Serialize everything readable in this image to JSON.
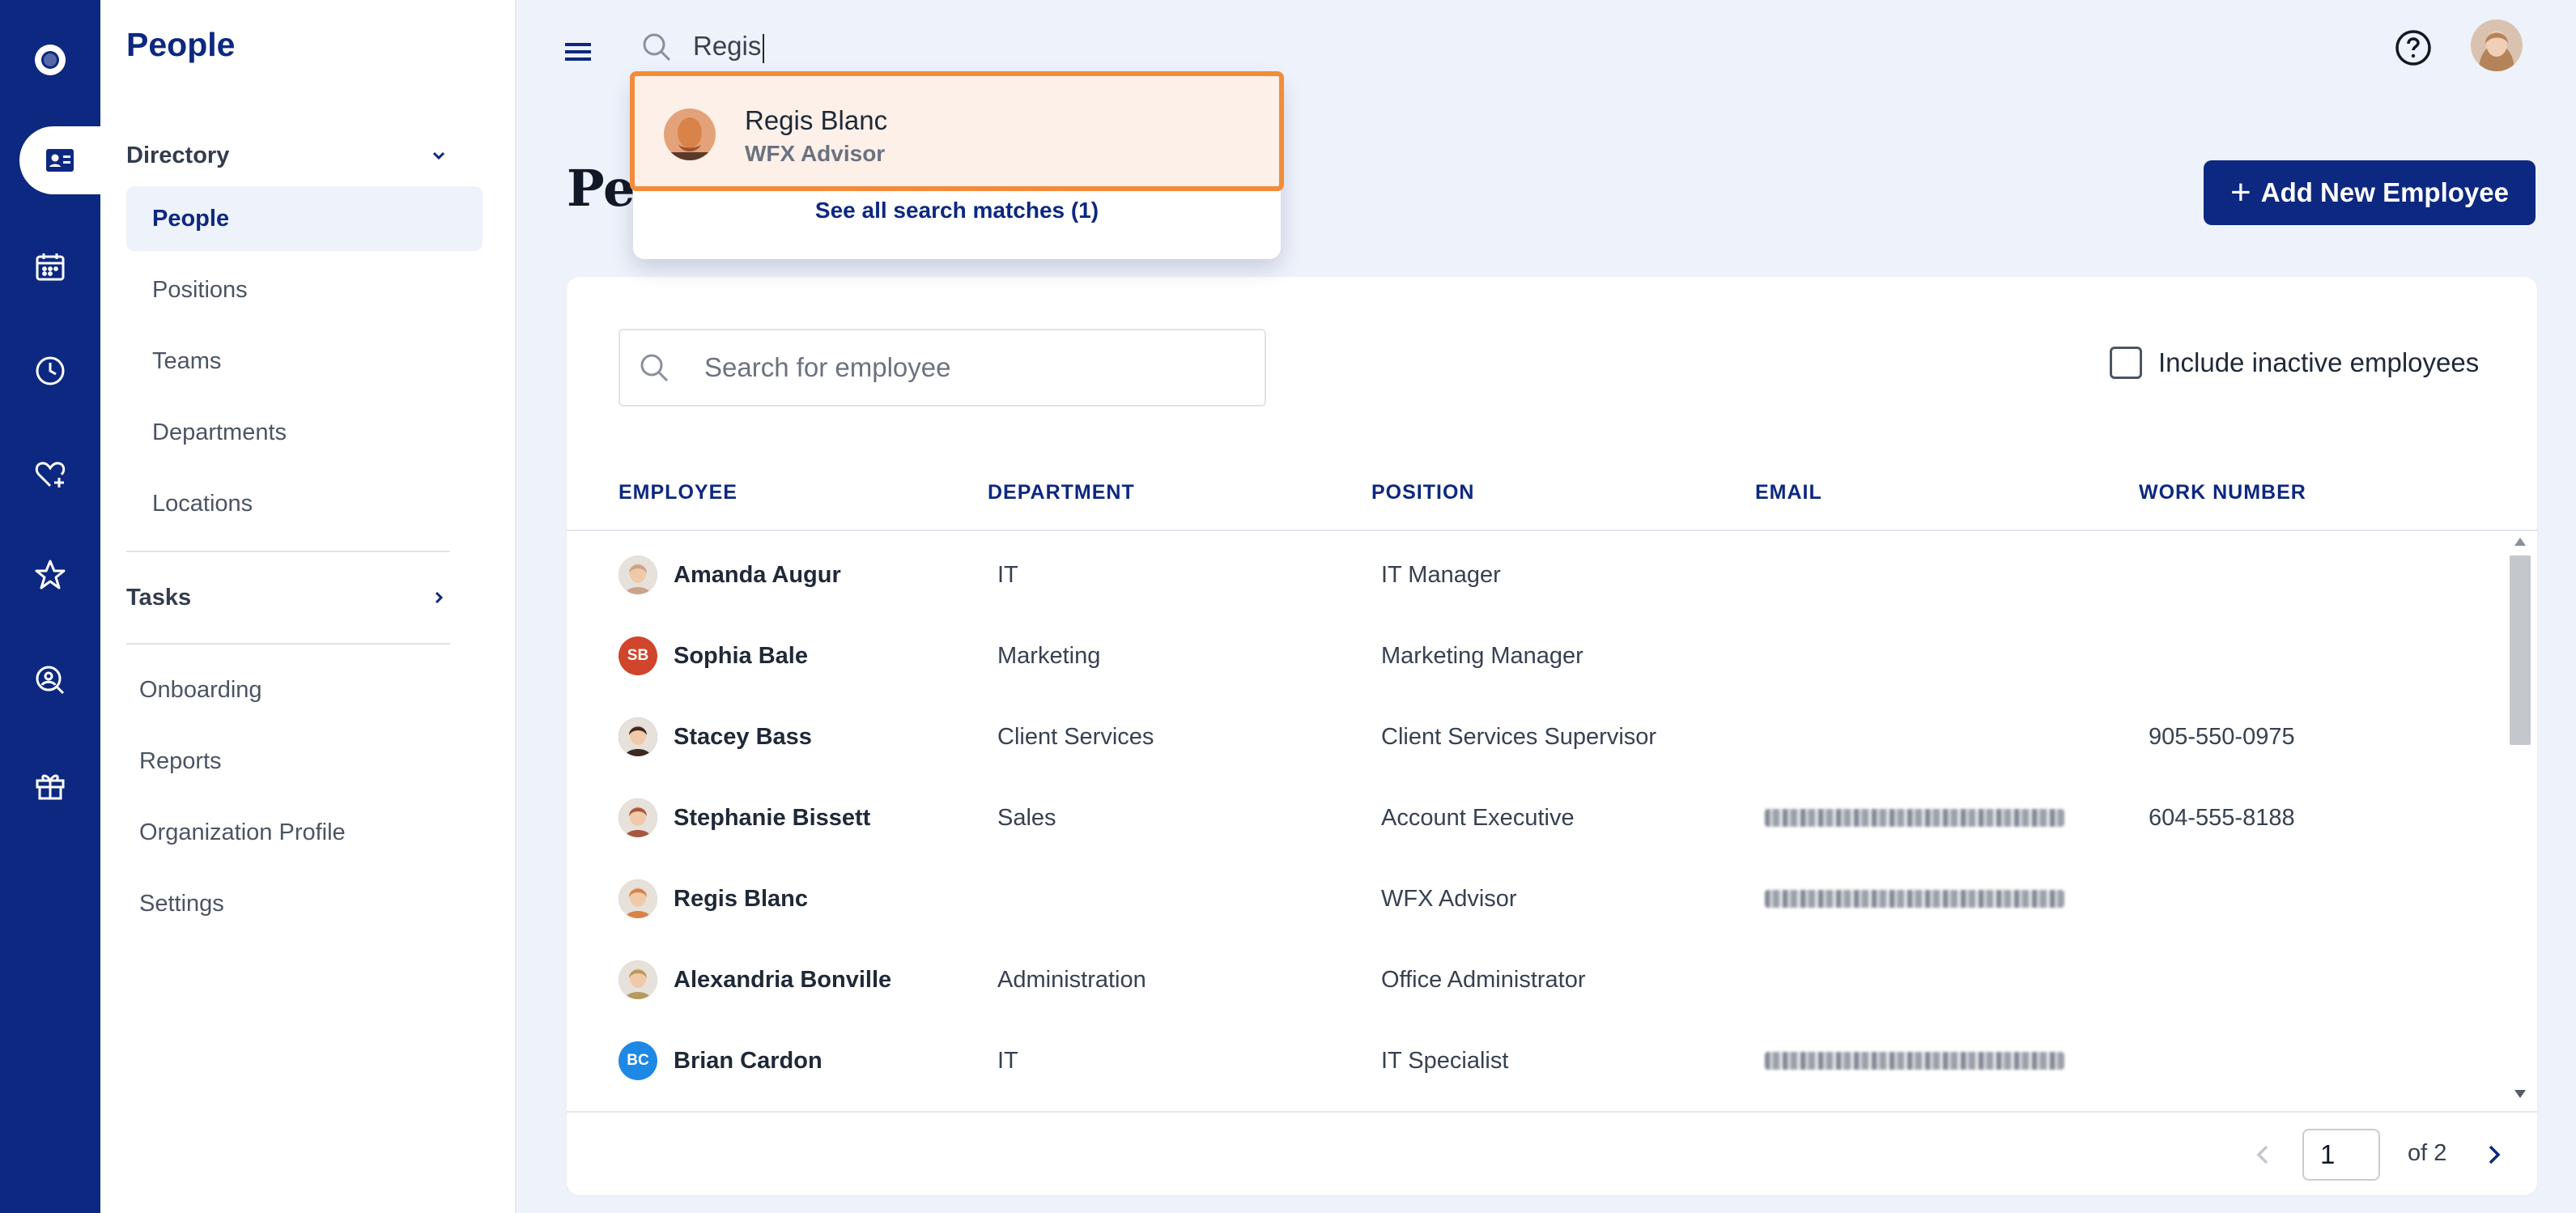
{
  "sidenav": {
    "title": "People",
    "directory": {
      "label": "Directory",
      "items": [
        {
          "label": "People",
          "active": true
        },
        {
          "label": "Positions"
        },
        {
          "label": "Teams"
        },
        {
          "label": "Departments"
        },
        {
          "label": "Locations"
        }
      ]
    },
    "tasks_label": "Tasks",
    "links": [
      "Onboarding",
      "Reports",
      "Organization Profile",
      "Settings"
    ]
  },
  "rail": {
    "icons": [
      "logo-icon",
      "people-card-icon",
      "calendar-icon",
      "clock-icon",
      "heart-plus-icon",
      "star-icon",
      "person-search-icon",
      "gift-icon"
    ],
    "active": "people-card-icon",
    "bg_color": "#0d2880"
  },
  "topbar": {
    "search_value": "Regis",
    "help_icon": "help-circle-icon"
  },
  "search_dropdown": {
    "match": {
      "name": "Regis Blanc",
      "role": "WFX Advisor"
    },
    "see_all": "See all search matches (1)"
  },
  "page": {
    "title": "People",
    "add_button": "Add New Employee"
  },
  "employee_search": {
    "placeholder": "Search for employee"
  },
  "inactive_toggle": {
    "label": "Include inactive employees",
    "checked": false
  },
  "table": {
    "columns": [
      "EMPLOYEE",
      "DEPARTMENT",
      "POSITION",
      "EMAIL",
      "WORK NUMBER"
    ],
    "rows": [
      {
        "name": "Amanda Augur",
        "department": "IT",
        "position": "IT Manager",
        "email_blurred": false,
        "work_number": "",
        "avatar": {
          "type": "photo",
          "color": "#c9a48a"
        }
      },
      {
        "name": "Sophia Bale",
        "department": "Marketing",
        "position": "Marketing Manager",
        "email_blurred": false,
        "work_number": "",
        "avatar": {
          "type": "initials",
          "initials": "SB",
          "color": "#d0452b"
        }
      },
      {
        "name": "Stacey Bass",
        "department": "Client Services",
        "position": "Client Services Supervisor",
        "email_blurred": false,
        "work_number": "905-550-0975",
        "avatar": {
          "type": "photo",
          "color": "#3b2a24"
        }
      },
      {
        "name": "Stephanie Bissett",
        "department": "Sales",
        "position": "Account Executive",
        "email_blurred": true,
        "work_number": "604-555-8188",
        "avatar": {
          "type": "photo",
          "color": "#a8573e"
        }
      },
      {
        "name": "Regis Blanc",
        "department": "",
        "position": "WFX Advisor",
        "email_blurred": true,
        "work_number": "",
        "avatar": {
          "type": "photo",
          "color": "#d9824a"
        }
      },
      {
        "name": "Alexandria Bonville",
        "department": "Administration",
        "position": "Office Administrator",
        "email_blurred": false,
        "work_number": "",
        "avatar": {
          "type": "photo",
          "color": "#b89a5e"
        }
      },
      {
        "name": "Brian Cardon",
        "department": "IT",
        "position": "IT Specialist",
        "email_blurred": true,
        "work_number": "",
        "avatar": {
          "type": "initials",
          "initials": "BC",
          "color": "#1e88e5"
        }
      }
    ]
  },
  "pagination": {
    "current": "1",
    "of_label": "of 2"
  }
}
